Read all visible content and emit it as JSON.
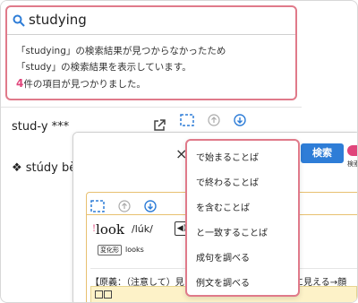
{
  "search": {
    "query": "studying",
    "message_line1": "「studying」の検索結果が見つからなかったため",
    "message_line2": "「study」の検索結果を表示しています。",
    "count_number": "4",
    "count_suffix": "件の項目が見つかりました。"
  },
  "results": {
    "entry1": "stud-y ***",
    "entry2": "❖ stúdy bèd"
  },
  "front_panel": {
    "close": "×",
    "search_button": "検索",
    "toggle_label": "検索"
  },
  "dictionary": {
    "headword_mark": "!",
    "headword": "look",
    "pronunciation": "/lúk/",
    "speaker": "◀)",
    "form_tag": "変化形",
    "forms": "looks",
    "etymology": "【原義：（注意して）見",
    "etymology_tail": "…に見える→顔"
  },
  "menu": {
    "items": [
      "で始まることば",
      "で終わることば",
      "を含むことば",
      "と一致することば",
      "成句を調べる",
      "例文を調べる"
    ]
  },
  "colors": {
    "accent_pink": "#e0457b",
    "highlight_border": "#e07a8a",
    "primary_blue": "#2e7dd7"
  }
}
